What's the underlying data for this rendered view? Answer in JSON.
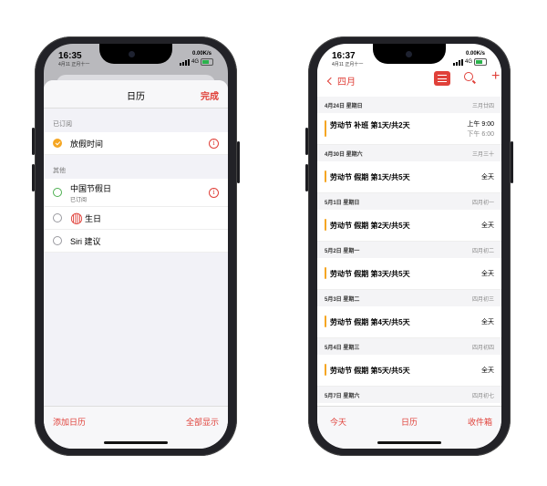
{
  "left_phone": {
    "status": {
      "time": "16:35",
      "date": "4月11 正月十一",
      "net": "0.00K/s",
      "signal": "4G"
    },
    "sheet": {
      "title": "日历",
      "done_label": "完成",
      "subscribed_label": "已订阅",
      "subscribed_items": [
        {
          "name": "放假时间"
        }
      ],
      "other_label": "其他",
      "other_items": [
        {
          "name": "中国节假日",
          "sub": "已订阅"
        },
        {
          "name": "生日",
          "icon": "birthday-icon"
        },
        {
          "name": "Siri 建议"
        }
      ],
      "add_label": "添加日历",
      "show_all_label": "全部显示"
    },
    "colors": {
      "accent": "#e0413a",
      "holiday": "#f5a623",
      "other_circle": "#4caf50"
    }
  },
  "right_phone": {
    "status": {
      "time": "16:37",
      "date": "4月11 正月十一",
      "net": "0.00K/s",
      "signal": "4G"
    },
    "nav": {
      "back_label": "四月"
    },
    "days": [
      {
        "date": "4月24日 星期日",
        "lunar": "三月廿四",
        "event": "劳动节 补班 第1天/共2天",
        "time1": "上午 9:00",
        "time2": "下午 6:00"
      },
      {
        "date": "4月30日 星期六",
        "lunar": "三月三十",
        "event": "劳动节 假期 第1天/共5天",
        "time": "全天"
      },
      {
        "date": "5月1日 星期日",
        "lunar": "四月初一",
        "event": "劳动节 假期 第2天/共5天",
        "time": "全天"
      },
      {
        "date": "5月2日 星期一",
        "lunar": "四月初二",
        "event": "劳动节 假期 第3天/共5天",
        "time": "全天"
      },
      {
        "date": "5月3日 星期二",
        "lunar": "四月初三",
        "event": "劳动节 假期 第4天/共5天",
        "time": "全天"
      },
      {
        "date": "5月4日 星期三",
        "lunar": "四月初四",
        "event": "劳动节 假期 第5天/共5天",
        "time": "全天"
      },
      {
        "date": "5月7日 星期六",
        "lunar": "四月初七"
      }
    ],
    "tabs": {
      "today": "今天",
      "calendars": "日历",
      "inbox": "收件箱"
    }
  }
}
